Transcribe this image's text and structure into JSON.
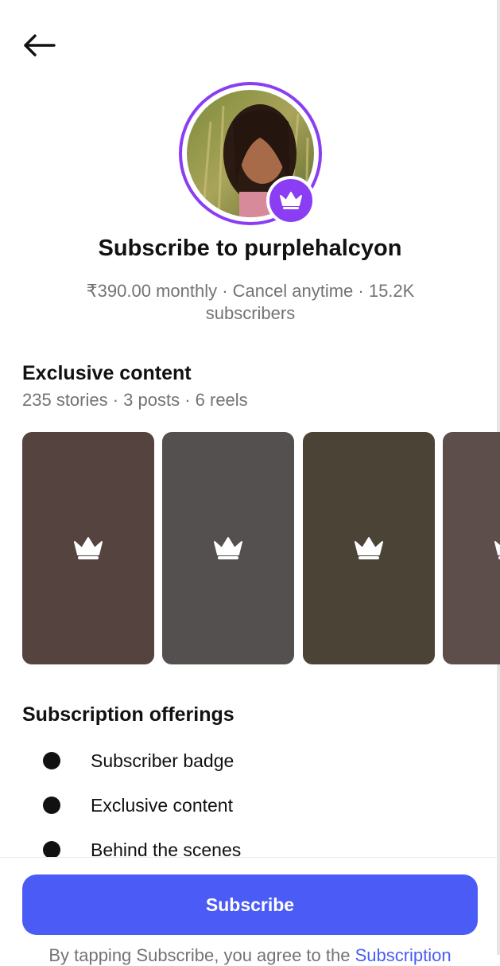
{
  "header": {
    "back_icon": "arrow-left-icon"
  },
  "profile": {
    "badge_icon": "crown-icon",
    "title": "Subscribe to purplehalcyon",
    "subtitle": "₹390.00 monthly · Cancel anytime · 15.2K subscribers"
  },
  "exclusive": {
    "heading": "Exclusive content",
    "counts": "235 stories · 3 posts · 6 reels",
    "tile_icon": "crown-icon",
    "tile_colors": [
      "#54433f",
      "#545050",
      "#4a4336",
      "#5e4e4b"
    ]
  },
  "offerings": {
    "heading": "Subscription offerings",
    "items": [
      "Subscriber badge",
      "Exclusive content",
      "Behind the scenes"
    ]
  },
  "footer": {
    "subscribe_label": "Subscribe",
    "terms_prefix": "By tapping Subscribe, you agree to the ",
    "terms_link": "Subscription"
  },
  "colors": {
    "accent_purple": "#8a3df2",
    "button_blue": "#4a5cf5",
    "muted_text": "#737373"
  }
}
